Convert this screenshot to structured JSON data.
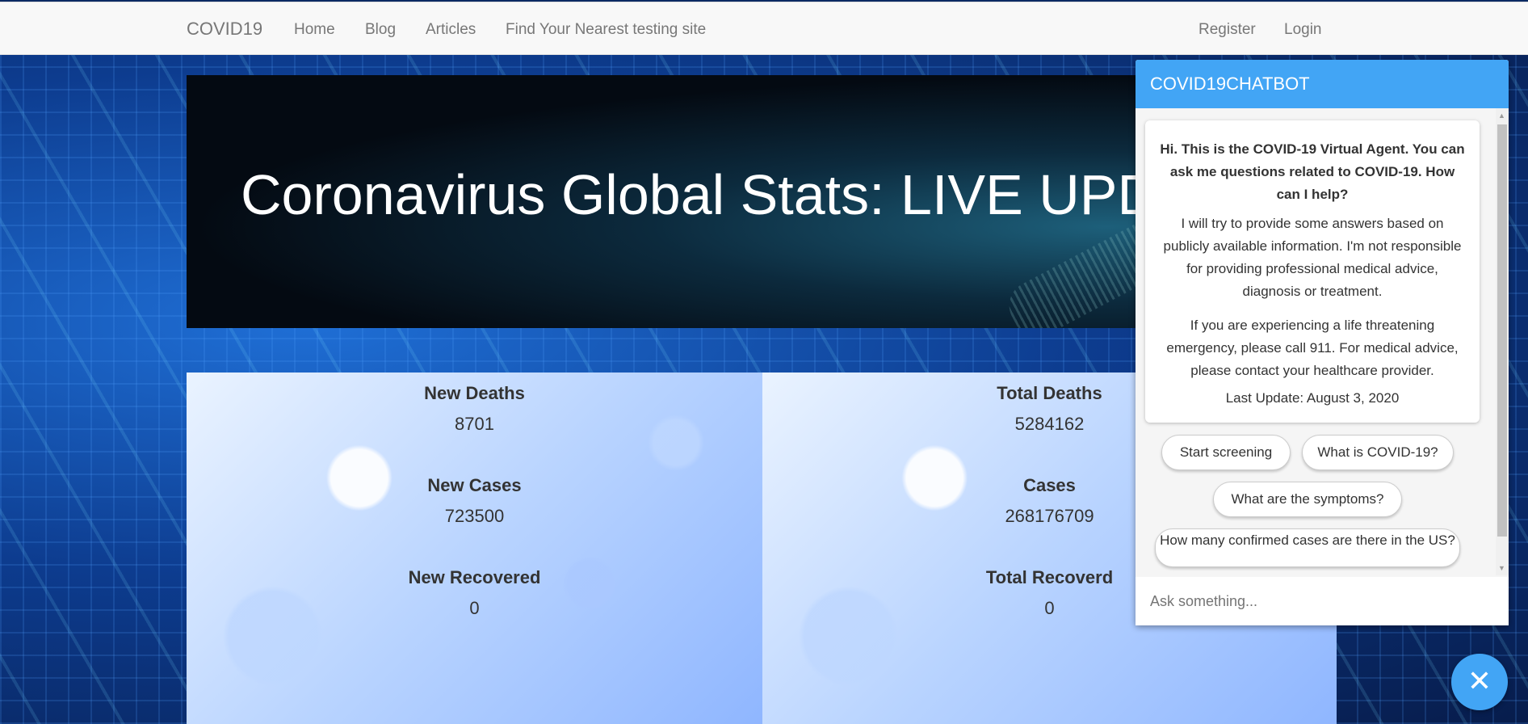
{
  "navbar": {
    "brand": "COVID19",
    "links": [
      "Home",
      "Blog",
      "Articles",
      "Find Your Nearest testing site"
    ],
    "right_links": [
      "Register",
      "Login"
    ]
  },
  "hero": {
    "title": "Coronavirus Global Stats: LIVE UPDATES"
  },
  "stats_left": [
    {
      "label": "New Deaths",
      "value": "8701"
    },
    {
      "label": "New Cases",
      "value": "723500"
    },
    {
      "label": "New Recovered",
      "value": "0"
    }
  ],
  "stats_right": [
    {
      "label": "Total Deaths",
      "value": "5284162"
    },
    {
      "label": "Cases",
      "value": "268176709"
    },
    {
      "label": "Total Recoverd",
      "value": "0"
    }
  ],
  "chatbot": {
    "title": "COVID19CHATBOT",
    "greeting": "Hi. This is the COVID-19 Virtual Agent. You can ask me questions related to COVID-19. How can I help?",
    "disclaimer": "I will try to provide some answers based on publicly available information. I'm not responsible for providing professional medical advice, diagnosis or treatment.",
    "emergency": "If you are experiencing a life threatening emergency, please call 911. For medical advice, please contact your healthcare provider.",
    "last_update": "Last Update: August 3, 2020",
    "quick_replies": [
      "Start screening",
      "What is COVID-19?",
      "What are the symptoms?",
      "How many confirmed cases are there in the US?"
    ],
    "input_placeholder": "Ask something...",
    "close_glyph": "✕"
  },
  "colors": {
    "chat_accent": "#42a5f5",
    "navbar_bg": "#f8f8f8"
  }
}
